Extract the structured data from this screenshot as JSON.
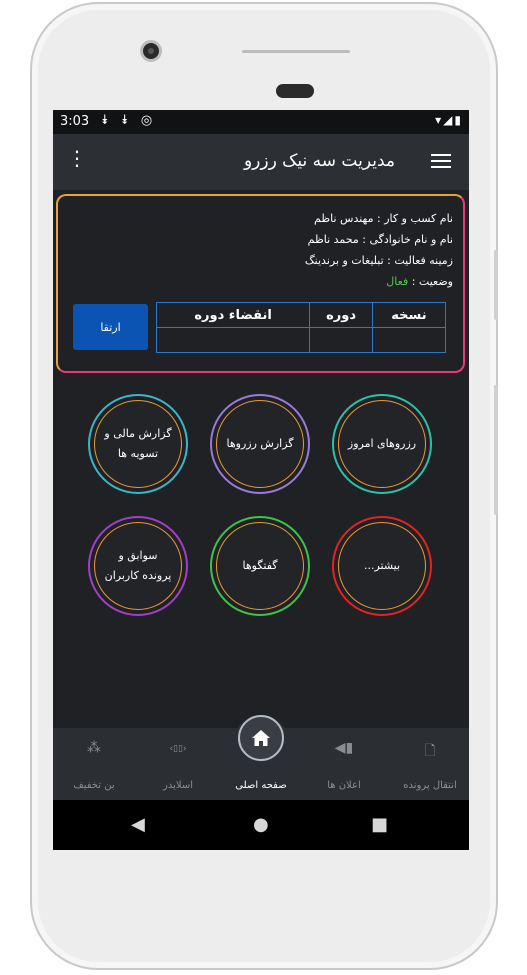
{
  "status": {
    "time": "3:03",
    "left_icons": "⯯ ⯯ ◎",
    "right_icons": "▾◢▮"
  },
  "appbar": {
    "title": "مدیریت سه نیک رزرو",
    "overflow_icon": "more-vert-icon",
    "nav_icon": "hamburger-icon"
  },
  "profile": {
    "business": "نام کسب و کار : مهندس ناظم",
    "name": "نام و نام خانوادگی : محمد ناظم",
    "field": "زمینه فعالیت : تبلیغات و برندینگ",
    "status_label": "وضعیت : ",
    "status_value": "فعال"
  },
  "colors": {
    "status_active": "#4fc84f",
    "upgrade_button": "#0b54b4",
    "table_border": "#2c78c8"
  },
  "table": {
    "headers": [
      "نسخه",
      "دوره",
      "انقضاء دوره"
    ],
    "values": [
      "",
      "",
      ""
    ]
  },
  "upgrade_label": "ارتقا",
  "tiles": [
    {
      "label": "رزروهای امروز",
      "ring": "#2ec0a8"
    },
    {
      "label": "گزارش رزروها",
      "ring": "#9a7ad8"
    },
    {
      "label": "گزارش مالی و تسویه ها",
      "ring": "#3ab6c8"
    },
    {
      "label": "بیشتر...",
      "ring": "#e02424"
    },
    {
      "label": "گفتگوها",
      "ring": "#3ec24a"
    },
    {
      "label": "سوابق و پرونده کاربران",
      "ring": "#a13ec8"
    }
  ],
  "bottom_nav": [
    {
      "label": "انتقال پرونده",
      "icon": "file-transfer-icon"
    },
    {
      "label": "اعلان ها",
      "icon": "megaphone-icon"
    },
    {
      "label": "صفحه اصلی",
      "icon": "home-icon"
    },
    {
      "label": "اسلایدر",
      "icon": "slider-icon"
    },
    {
      "label": "بن تخفیف",
      "icon": "discount-icon"
    }
  ]
}
